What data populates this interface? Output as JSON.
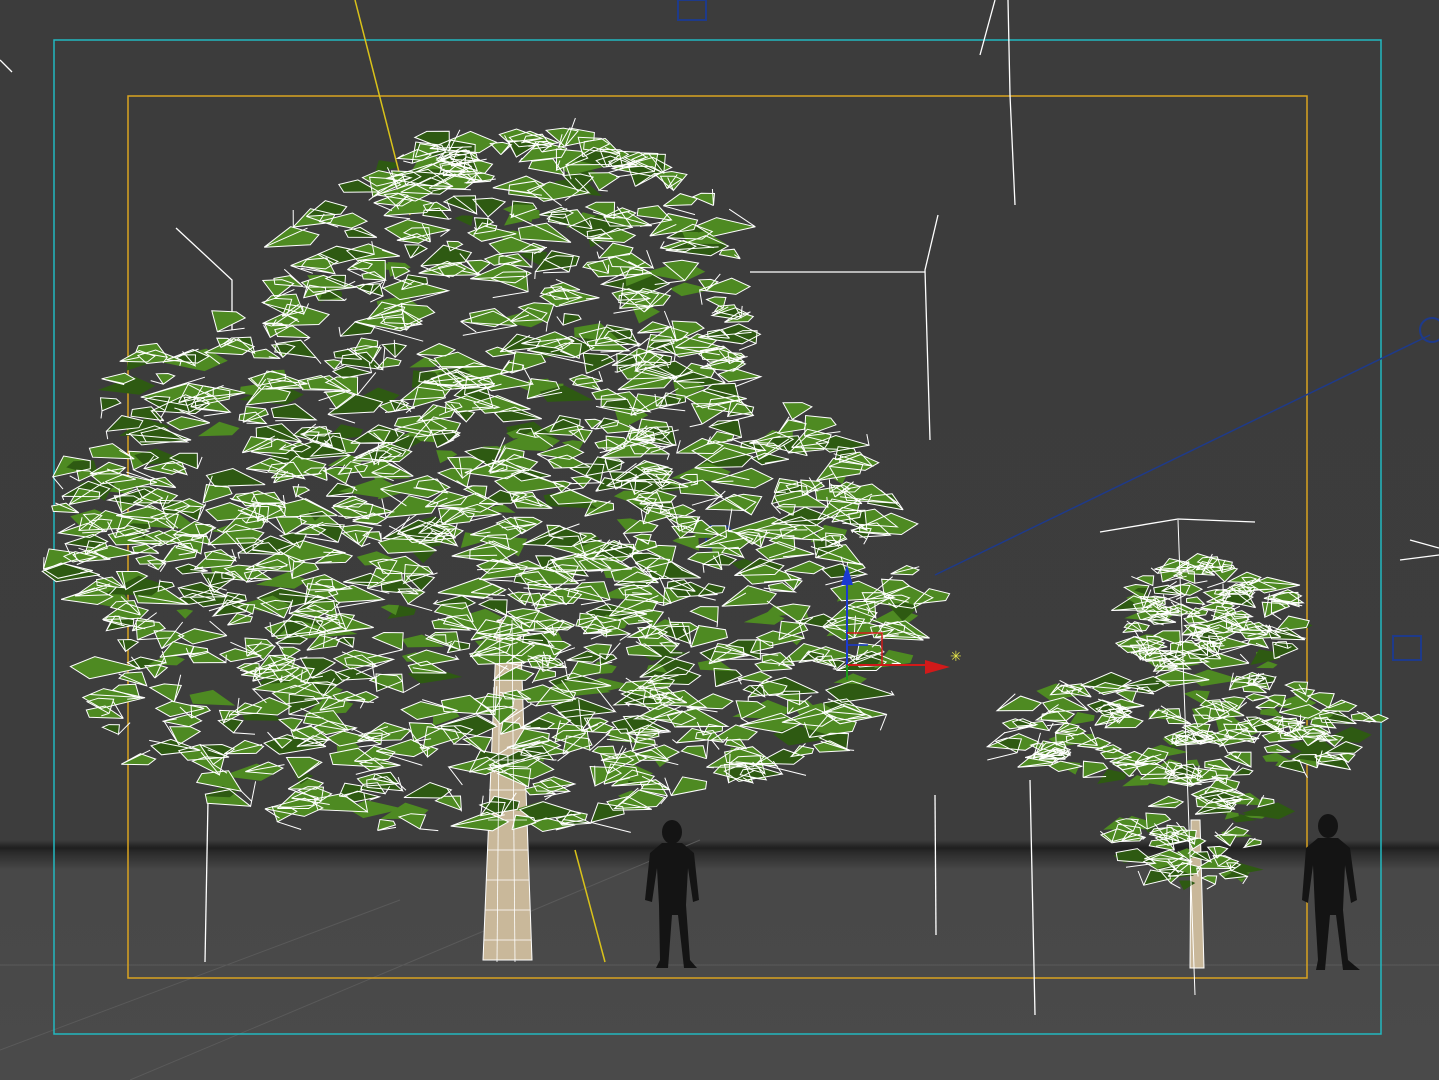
{
  "viewport": {
    "colors": {
      "background": "#3d3d3d",
      "floor": "#4a4a4a",
      "wireframe": "#ffffff",
      "foliage": "#4e8a22",
      "foliage_dark": "#2e5a12",
      "trunk": "#c9b89a",
      "safe_frame_outer": "#22b8c0",
      "safe_frame_inner": "#d9a320",
      "target_line": "#d9c21a",
      "light_line": "#1e3a8a",
      "silhouette": "#141414"
    },
    "objects": {
      "large_tree": "tree",
      "small_tree": "tree",
      "person_left": "human-silhouette",
      "person_right": "human-silhouette"
    },
    "gizmo": {
      "x_axis_color": "#d11a1a",
      "y_axis_color": "#1a9a1a",
      "z_axis_color": "#1a3ad1",
      "center_color": "#e8e84a"
    }
  }
}
